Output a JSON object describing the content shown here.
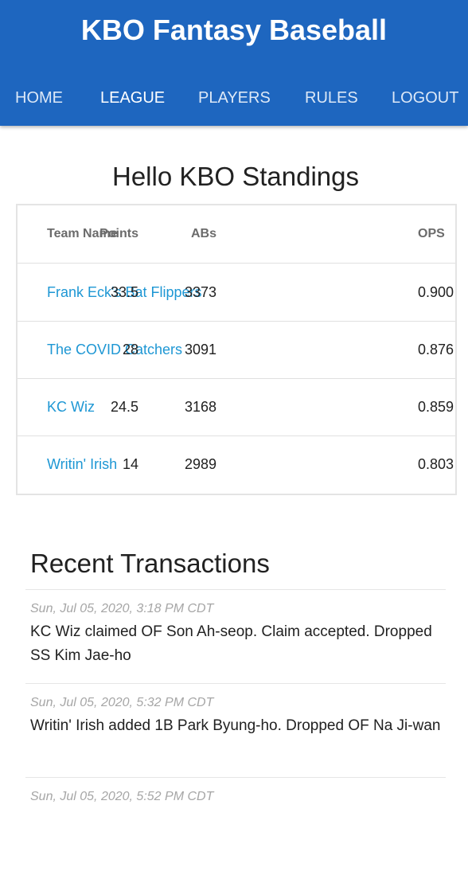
{
  "app": {
    "title": "KBO Fantasy Baseball"
  },
  "nav": {
    "items": [
      {
        "label": "HOME"
      },
      {
        "label": "LEAGUE"
      },
      {
        "label": "PLAYERS"
      },
      {
        "label": "RULES"
      },
      {
        "label": "LOGOUT"
      }
    ],
    "active": "LEAGUE"
  },
  "page": {
    "title": "Hello KBO Standings"
  },
  "standings": {
    "columns": [
      "Team Name",
      "Points",
      "ABs",
      "OPS"
    ],
    "rows": [
      {
        "team": "Frank Eck's Bat Flippers",
        "points": "33.5",
        "abs": "3373",
        "ops": "0.900"
      },
      {
        "team": "The COVID Catchers",
        "points": "28",
        "abs": "3091",
        "ops": "0.876"
      },
      {
        "team": "KC Wiz",
        "points": "24.5",
        "abs": "3168",
        "ops": "0.859"
      },
      {
        "team": "Writin' Irish",
        "points": "14",
        "abs": "2989",
        "ops": "0.803"
      }
    ]
  },
  "transactions": {
    "title": "Recent Transactions",
    "items": [
      {
        "time": "Sun, Jul 05, 2020, 3:18 PM CDT",
        "text": "KC Wiz claimed OF Son Ah-seop. Claim accepted. Dropped SS Kim Jae-ho"
      },
      {
        "time": "Sun, Jul 05, 2020, 5:32 PM CDT",
        "text": "Writin' Irish added 1B Park Byung-ho. Dropped OF Na Ji-wan"
      },
      {
        "time": "Sun, Jul 05, 2020, 5:52 PM CDT",
        "text": ""
      }
    ]
  },
  "colors": {
    "header": "#1e66bf",
    "link": "#1e97d4",
    "timestamp": "#a6a6a6"
  }
}
